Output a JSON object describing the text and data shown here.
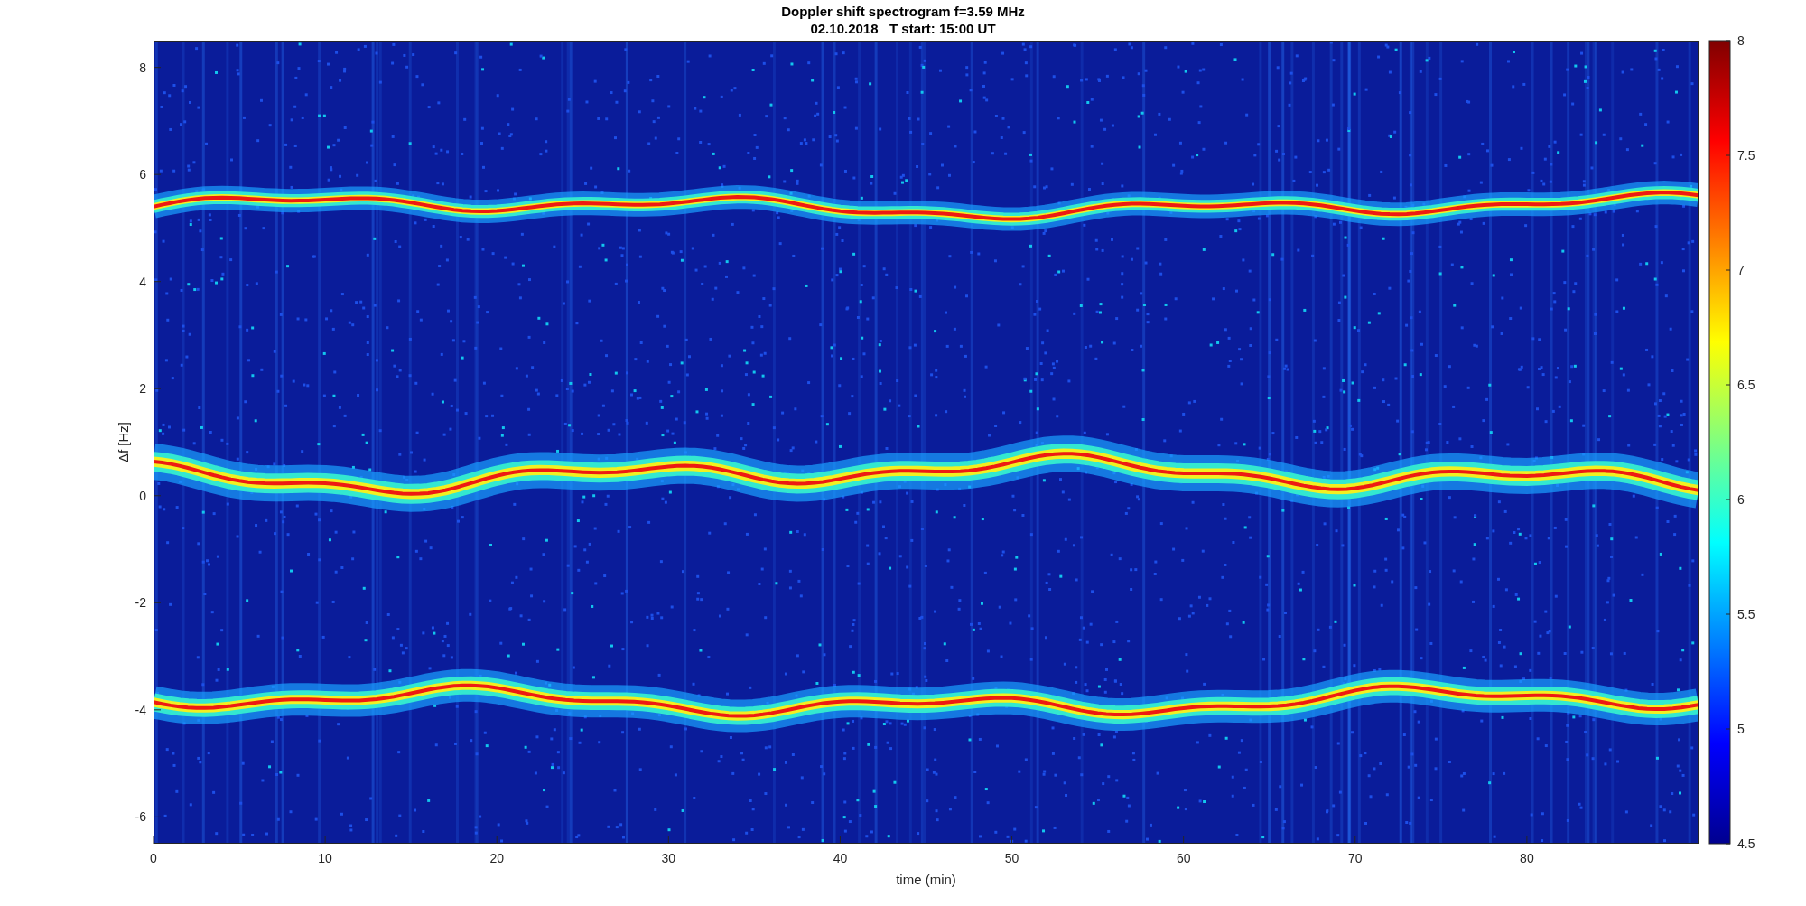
{
  "figure": {
    "title": "Doppler shift spectrogram f=3.59 MHz",
    "subtitle": "02.10.2018   T start: 15:00 UT",
    "axes": {
      "xlabel": "time (min)",
      "ylabel": "Δf [Hz]",
      "xticks": [
        "0",
        "10",
        "20",
        "30",
        "40",
        "50",
        "60",
        "70",
        "80"
      ],
      "yticks": [
        "8",
        "6",
        "4",
        "2",
        "0",
        "-2",
        "-4",
        "-6"
      ]
    },
    "colorbar": {
      "ticks": [
        "8",
        "7.5",
        "7",
        "6.5",
        "6",
        "5.5",
        "5",
        "4.5"
      ]
    }
  }
}
